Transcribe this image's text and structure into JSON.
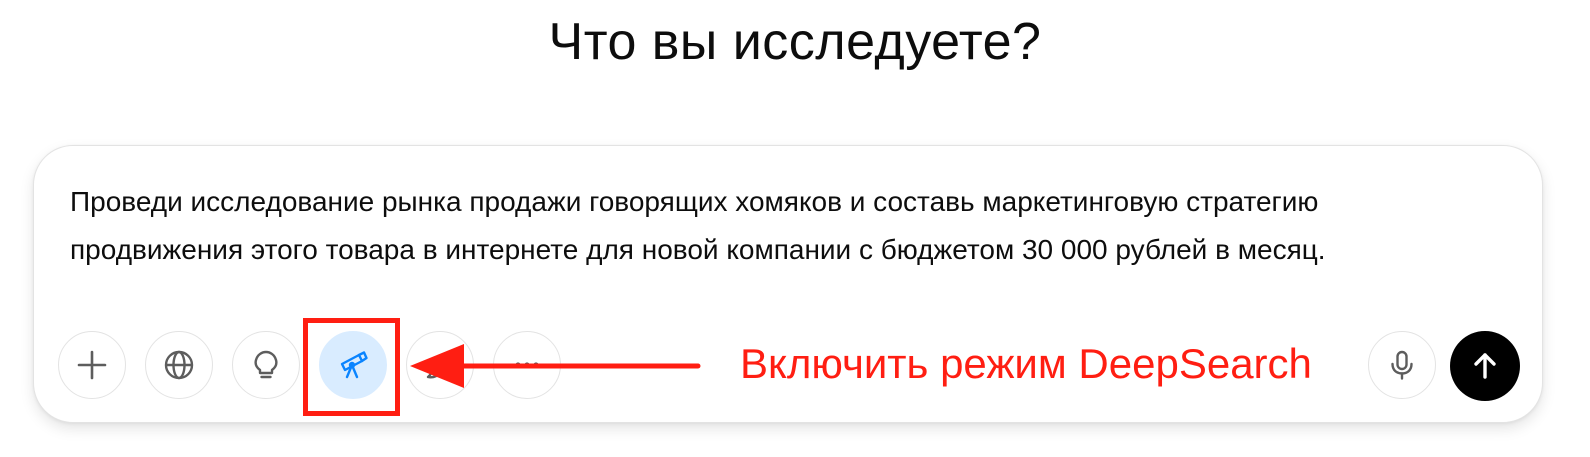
{
  "heading": "Что вы исследуете?",
  "composer": {
    "prompt": "Проведи исследование рынка продажи говорящих хомяков и составь маркетинговую стратегию продвижения этого товара в интернете для новой компании с бюджетом 30 000 рублей в месяц.",
    "tools": [
      {
        "icon": "plus-icon",
        "active": false
      },
      {
        "icon": "globe-icon",
        "active": false
      },
      {
        "icon": "lightbulb-icon",
        "active": false
      },
      {
        "icon": "telescope-icon",
        "active": true
      },
      {
        "icon": "paintbrush-icon",
        "active": false
      },
      {
        "icon": "more-icon",
        "active": false
      }
    ],
    "voice_icon": "microphone-icon",
    "send_icon": "arrow-up-icon"
  },
  "annotation": {
    "callout": "Включить режим DeepSearch",
    "color": "#ff1e12"
  },
  "colors": {
    "active_bg": "#d9ecff",
    "active_icon": "#0a84ff",
    "send_bg": "#000000"
  }
}
